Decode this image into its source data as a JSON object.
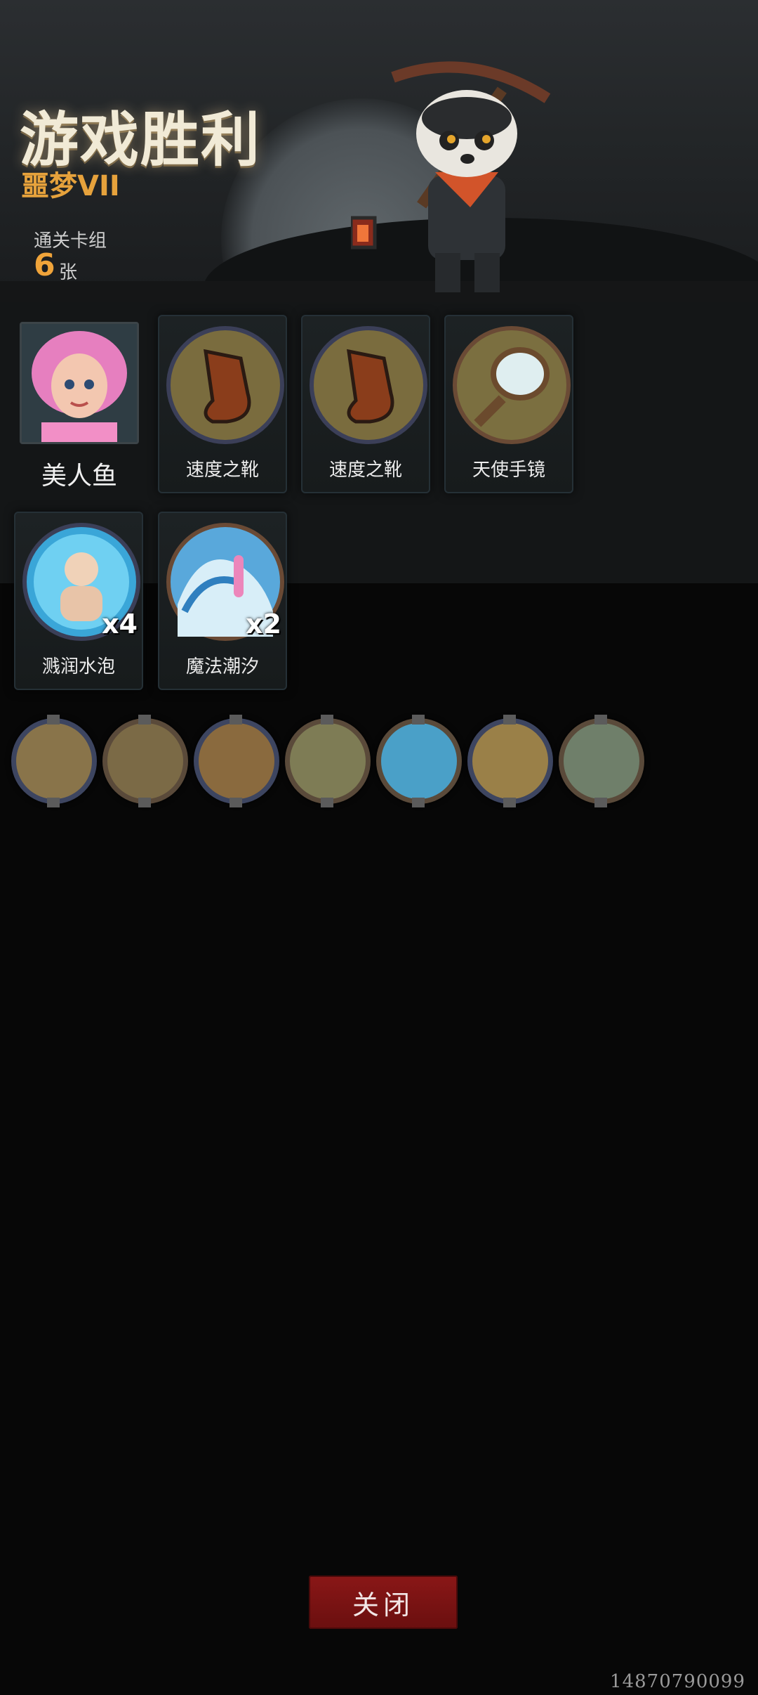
{
  "header": {
    "title": "游戏胜利",
    "subtitle": "噩梦VII",
    "deck_label": "通关卡组",
    "deck_count": "6",
    "deck_unit": "张"
  },
  "hero": {
    "name": "美人鱼"
  },
  "items": [
    {
      "label": "速度之靴",
      "icon": "boot-icon"
    },
    {
      "label": "速度之靴",
      "icon": "boot-icon"
    },
    {
      "label": "天使手镜",
      "icon": "hand-mirror-icon"
    }
  ],
  "skills": [
    {
      "label": "溅润水泡",
      "count": "x4",
      "icon": "water-bubble-icon",
      "color": "#3aa5e8"
    },
    {
      "label": "魔法潮汐",
      "count": "x2",
      "icon": "magic-tide-icon",
      "color": "#e1993a"
    }
  ],
  "companions": [
    "bee-warrior-icon",
    "water-splash-icon",
    "raccoon-icon",
    "viking-icon",
    "water-ripple-icon",
    "pig-icon",
    "mermaid-icon"
  ],
  "footer": {
    "close_label": "关闭",
    "watermark": "14870790099"
  }
}
